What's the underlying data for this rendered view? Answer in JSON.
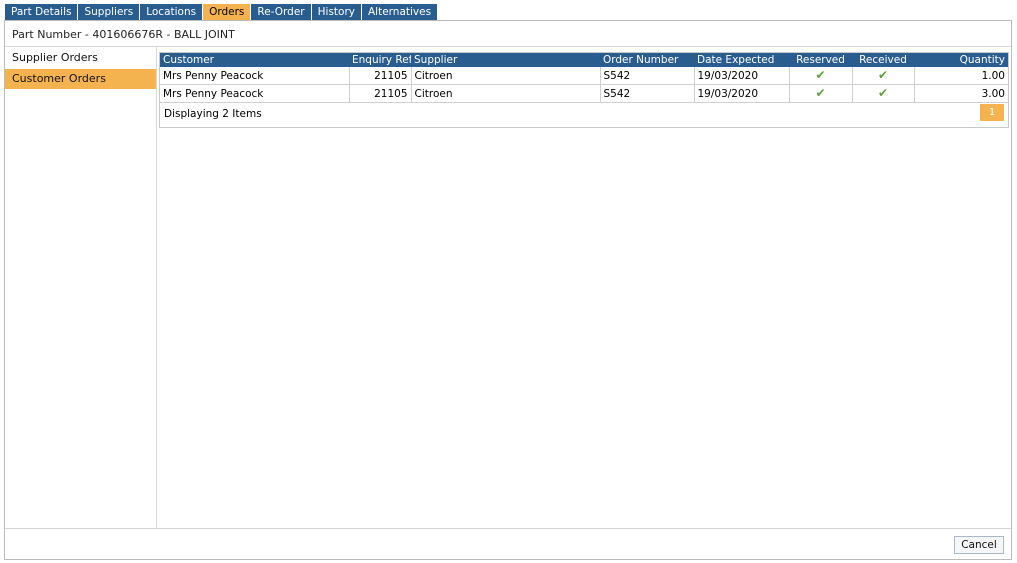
{
  "tabs": [
    "Part Details",
    "Suppliers",
    "Locations",
    "Orders",
    "Re-Order",
    "History",
    "Alternatives"
  ],
  "active_tab": "Orders",
  "title": "Part Number - 401606676R - BALL JOINT",
  "sidebar": {
    "items": [
      {
        "label": "Supplier Orders",
        "active": false
      },
      {
        "label": "Customer Orders",
        "active": true
      }
    ]
  },
  "grid": {
    "columns": {
      "customer": "Customer",
      "enquiry_ref": "Enquiry Ref",
      "supplier": "Supplier",
      "order_number": "Order Number",
      "date_expected": "Date Expected",
      "reserved": "Reserved",
      "received": "Received",
      "quantity": "Quantity"
    },
    "rows": [
      {
        "customer": "Mrs Penny Peacock",
        "enquiry_ref": "21105",
        "supplier": "Citroen",
        "order_number": "S542",
        "date_expected": "19/03/2020",
        "reserved": "✔",
        "received": "✔",
        "quantity": "1.00"
      },
      {
        "customer": "Mrs Penny Peacock",
        "enquiry_ref": "21105",
        "supplier": "Citroen",
        "order_number": "S542",
        "date_expected": "19/03/2020",
        "reserved": "✔",
        "received": "✔",
        "quantity": "3.00"
      }
    ],
    "display_count": "Displaying 2 Items",
    "page": "1"
  },
  "footer": {
    "cancel_label": "Cancel"
  },
  "colors": {
    "header_blue": "#2a5d8f",
    "accent_orange": "#f5b350",
    "check_green": "#5ea23a"
  }
}
